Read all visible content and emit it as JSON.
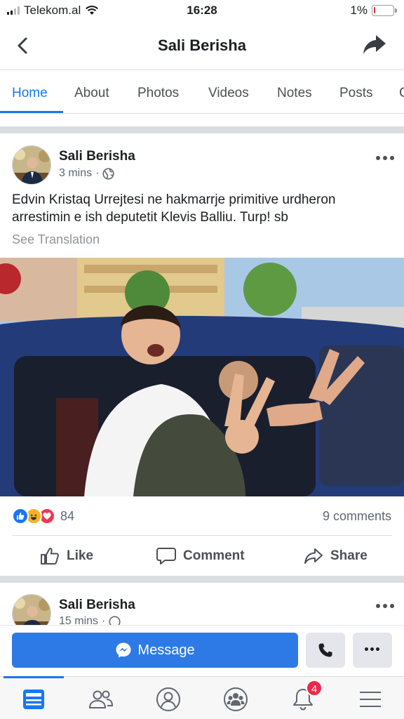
{
  "status_bar": {
    "carrier": "Telekom.al",
    "time": "16:28",
    "battery": "1%",
    "battery_level": 0.01
  },
  "header": {
    "title": "Sali Berisha",
    "back_icon": "chevron-left-icon",
    "share_icon": "share-arrow-icon"
  },
  "tabs": [
    {
      "label": "Home",
      "active": true
    },
    {
      "label": "About"
    },
    {
      "label": "Photos"
    },
    {
      "label": "Videos"
    },
    {
      "label": "Notes"
    },
    {
      "label": "Posts"
    },
    {
      "label": "C"
    }
  ],
  "post": {
    "author": "Sali Berisha",
    "time": "3 mins",
    "privacy_icon": "globe-icon",
    "text": "Edvin Kristaq Urrejtesi ne hakmarrje primitive urdheron arrestimin e ish deputetit Klevis Balliu. Turp! sb",
    "see_translation": "See Translation",
    "reaction_count": "84",
    "comments": "9 comments",
    "actions": {
      "like": "Like",
      "comment": "Comment",
      "share": "Share"
    }
  },
  "next_post": {
    "author": "Sali Berisha",
    "time": "15 mins"
  },
  "cta": {
    "message": "Message"
  },
  "bottom_nav": {
    "notifications_badge": "4"
  },
  "colors": {
    "brand": "#1877f2",
    "message_button": "#2d7ae6",
    "badge": "#f02849"
  }
}
